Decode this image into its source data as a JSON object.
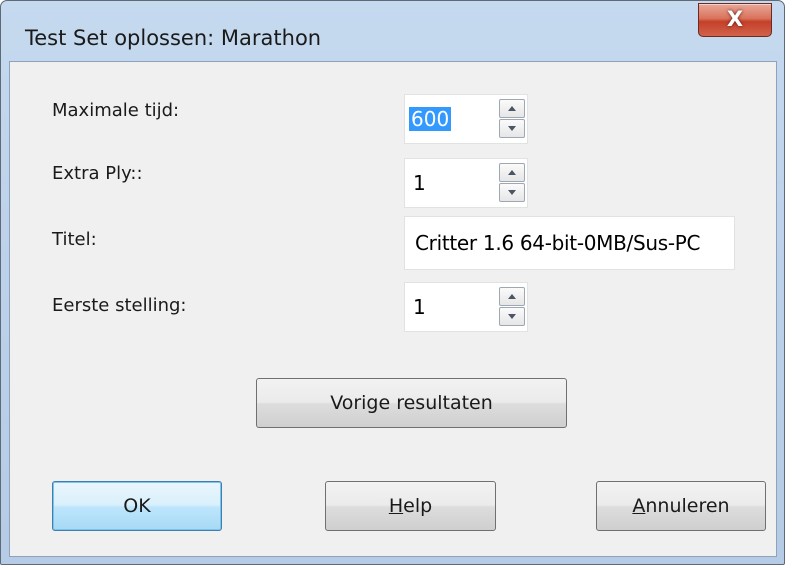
{
  "window": {
    "title": "Test Set oplossen: Marathon",
    "close_glyph": "X"
  },
  "fields": {
    "max_time": {
      "label": "Maximale tijd:",
      "value": "600"
    },
    "extra_ply": {
      "label": "Extra Ply::",
      "value": "1"
    },
    "title": {
      "label": "Titel:",
      "value": "Critter 1.6 64-bit-0MB/Sus-PC"
    },
    "first_position": {
      "label": "Eerste stelling:",
      "value": "1"
    }
  },
  "buttons": {
    "previous_results": "Vorige resultaten",
    "ok": "OK",
    "help_mnemonic": "H",
    "help_rest": "elp",
    "cancel_mnemonic": "A",
    "cancel_rest": "nnuleren"
  },
  "icons": {
    "close": "close-icon",
    "spin_up": "chevron-up-icon",
    "spin_down": "chevron-down-icon"
  },
  "colors": {
    "selection": "#3399ff",
    "close_button": "#c4402a",
    "default_button_border": "#3c7fb1"
  }
}
